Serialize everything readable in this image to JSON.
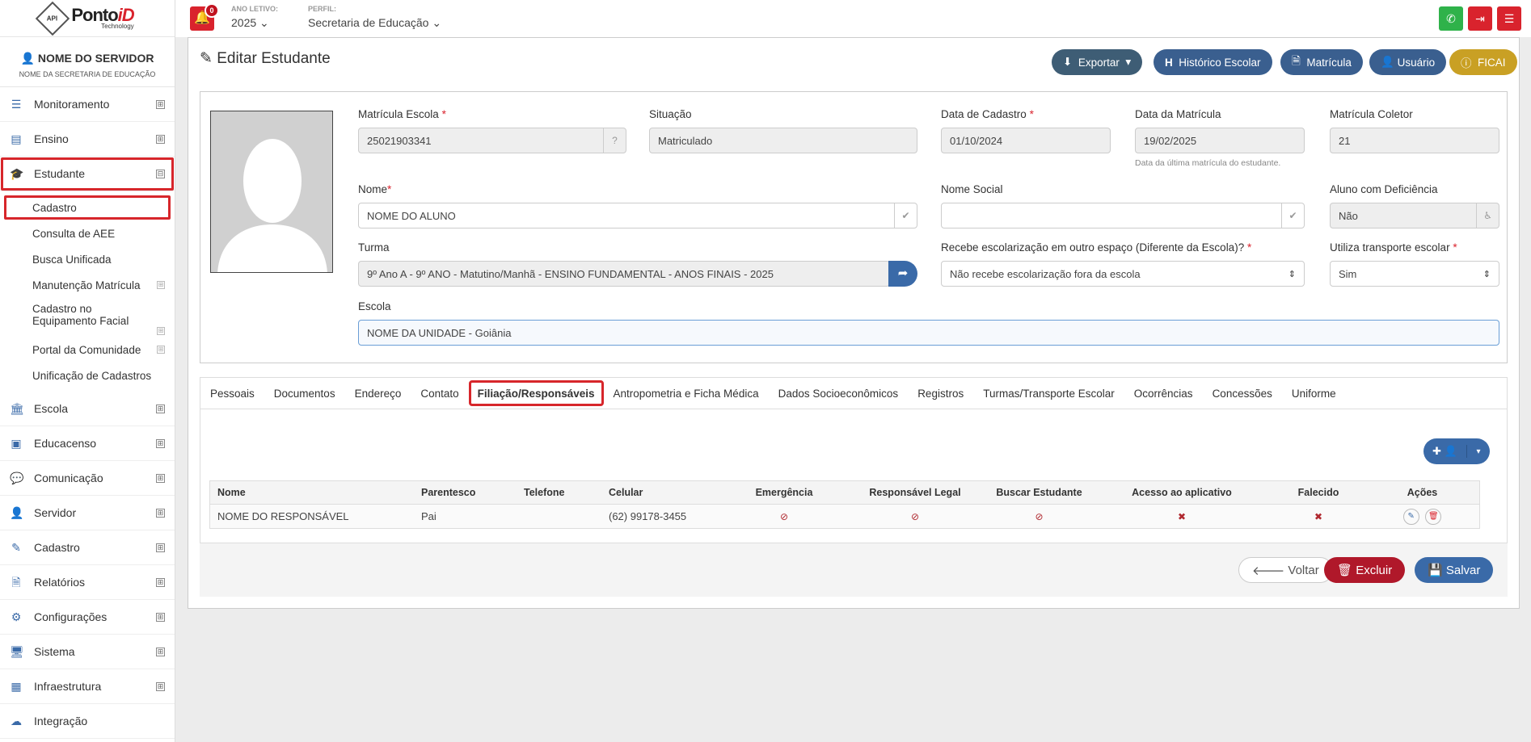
{
  "logo": {
    "badge": "API",
    "brand": "Ponto",
    "brand_accent": "iD",
    "sub": "Technology"
  },
  "user": {
    "name": "NOME DO SERVIDOR",
    "sub": "NOME DA SECRETARIA DE EDUCAÇÃO"
  },
  "topbar": {
    "notif_count": "0",
    "ano_label": "ANO LETIVO:",
    "ano_value": "2025",
    "perfil_label": "PERFIL:",
    "perfil_value": "Secretaria de Educação"
  },
  "menu": {
    "items_top": [
      {
        "label": "Monitoramento",
        "pm": "⊞"
      },
      {
        "label": "Ensino",
        "pm": "⊞"
      },
      {
        "label": "Estudante",
        "pm": "⊟"
      }
    ],
    "sub_items": [
      {
        "label": "Cadastro"
      },
      {
        "label": "Consulta de AEE"
      },
      {
        "label": "Busca Unificada"
      },
      {
        "label": "Manutenção Matrícula",
        "pm": "⊞"
      },
      {
        "label": "Cadastro no Equipamento Facial",
        "pm": "⊞"
      },
      {
        "label": "Portal da Comunidade",
        "pm": "⊞"
      },
      {
        "label": "Unificação de Cadastros"
      }
    ],
    "items_bottom": [
      {
        "label": "Escola",
        "pm": "⊞"
      },
      {
        "label": "Educacenso",
        "pm": "⊞"
      },
      {
        "label": "Comunicação",
        "pm": "⊞"
      },
      {
        "label": "Servidor",
        "pm": "⊞"
      },
      {
        "label": "Cadastro",
        "pm": "⊞"
      },
      {
        "label": "Relatórios",
        "pm": "⊞"
      },
      {
        "label": "Configurações",
        "pm": "⊞"
      },
      {
        "label": "Sistema",
        "pm": "⊞"
      },
      {
        "label": "Infraestrutura",
        "pm": "⊞"
      },
      {
        "label": "Integração"
      }
    ]
  },
  "page": {
    "title": "Editar Estudante",
    "buttons": {
      "exportar": "Exportar",
      "historico": "Histórico Escolar",
      "matricula": "Matrícula",
      "usuario": "Usuário",
      "ficai": "FICAI"
    }
  },
  "form": {
    "matricula_escola": {
      "label": "Matrícula Escola",
      "value": "25021903341"
    },
    "situacao": {
      "label": "Situação",
      "value": "Matriculado"
    },
    "data_cadastro": {
      "label": "Data de Cadastro",
      "value": "01/10/2024"
    },
    "data_matricula": {
      "label": "Data da Matrícula",
      "value": "19/02/2025",
      "hint": "Data da última matrícula do estudante."
    },
    "matricula_coletor": {
      "label": "Matrícula Coletor",
      "value": "21"
    },
    "nome": {
      "label": "Nome",
      "value": "NOME DO ALUNO"
    },
    "nome_social": {
      "label": "Nome Social",
      "value": ""
    },
    "deficiencia": {
      "label": "Aluno com Deficiência",
      "value": "Não"
    },
    "turma": {
      "label": "Turma",
      "value": "9º Ano A - 9º ANO - Matutino/Manhã - ENSINO FUNDAMENTAL - ANOS FINAIS - 2025"
    },
    "escolarizacao": {
      "label": "Recebe escolarização em outro espaço (Diferente da Escola)?",
      "value": "Não recebe escolarização fora da escola"
    },
    "transporte": {
      "label": "Utiliza transporte escolar",
      "value": "Sim"
    },
    "escola": {
      "label": "Escola",
      "value": "NOME DA UNIDADE - Goiânia"
    }
  },
  "tabs": [
    "Pessoais",
    "Documentos",
    "Endereço",
    "Contato",
    "Filiação/Responsáveis",
    "Antropometria e Ficha Médica",
    "Dados Socioeconômicos",
    "Registros",
    "Turmas/Transporte Escolar",
    "Ocorrências",
    "Concessões",
    "Uniforme"
  ],
  "table": {
    "headers": [
      "Nome",
      "Parentesco",
      "Telefone",
      "Celular",
      "Emergência",
      "Responsável Legal",
      "Buscar Estudante",
      "Acesso ao aplicativo",
      "Falecido",
      "Ações"
    ],
    "row": {
      "nome": "NOME DO RESPONSÁVEL",
      "parentesco": "Pai",
      "telefone": "",
      "celular": "(62) 99178-3455"
    }
  },
  "footer": {
    "voltar": "Voltar",
    "excluir": "Excluir",
    "salvar": "Salvar"
  },
  "colors": {
    "primary": "#3a6aa8",
    "danger": "#b0182a",
    "warning": "#d4a017",
    "success": "#2fb24a",
    "slate": "#3e5d75"
  }
}
